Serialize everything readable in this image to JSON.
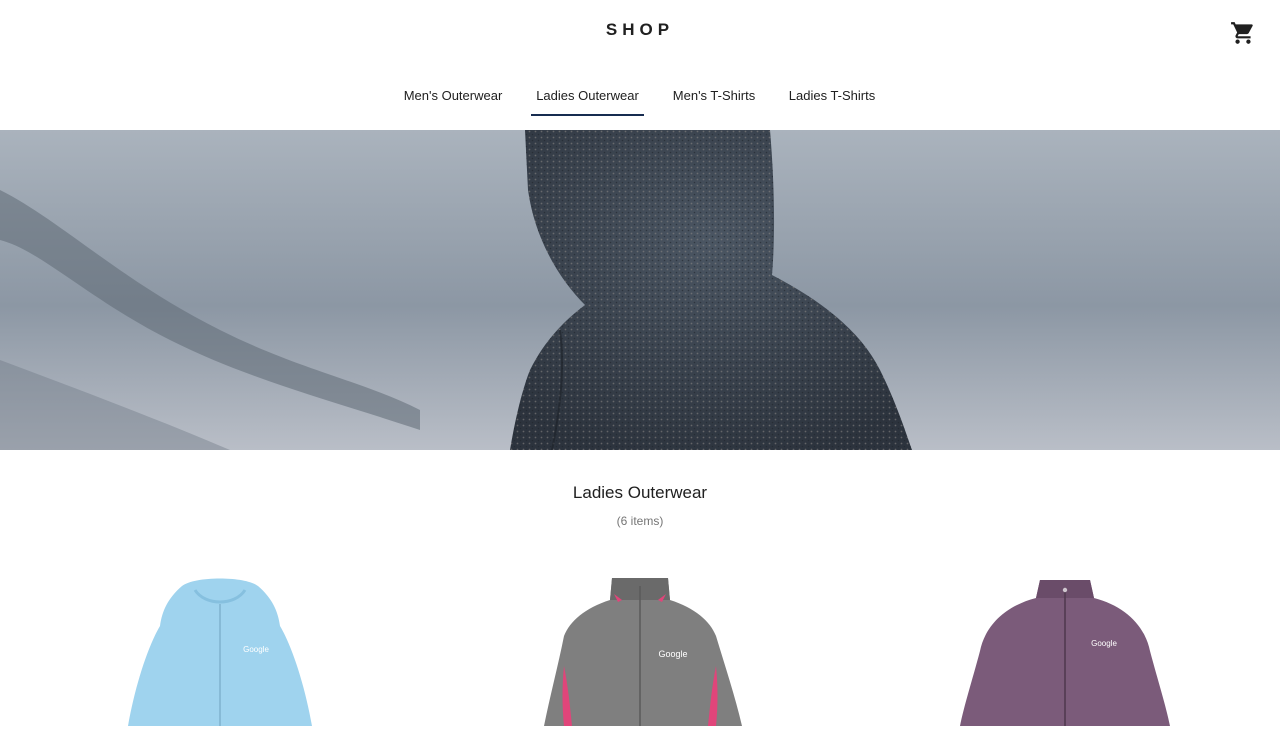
{
  "header": {
    "logo": "SHOP",
    "cart_icon": "shopping-cart-icon"
  },
  "tabs": [
    {
      "label": "Men's Outerwear",
      "active": false
    },
    {
      "label": "Ladies Outerwear",
      "active": true
    },
    {
      "label": "Men's T-Shirts",
      "active": false
    },
    {
      "label": "Ladies T-Shirts",
      "active": false
    }
  ],
  "hero": {
    "image": "person-in-hooded-sweater-image"
  },
  "category": {
    "title": "Ladies Outerwear",
    "count": "(6 items)"
  },
  "products": [
    {
      "image": "light-blue-hoodie-image",
      "logo_text": "Google",
      "color": "#9fd3ee"
    },
    {
      "image": "gray-pink-jacket-image",
      "logo_text": "Google",
      "color": "#7f7f7f"
    },
    {
      "image": "purple-fleece-jacket-image",
      "logo_text": "Google",
      "color": "#7b5b7a"
    }
  ],
  "colors": {
    "accent": "#172c50",
    "text": "#202020",
    "muted": "#757575"
  }
}
